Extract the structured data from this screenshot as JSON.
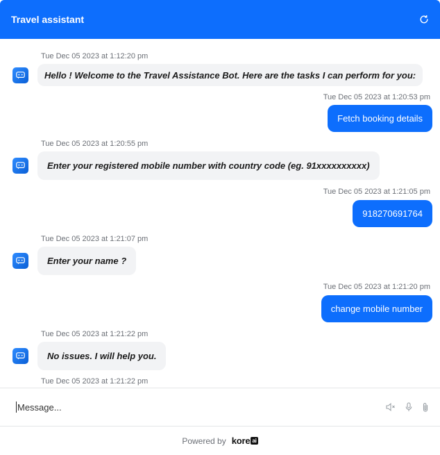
{
  "header": {
    "title": "Travel assistant",
    "refresh_icon": "refresh-icon"
  },
  "messages": [
    {
      "sender": "bot",
      "timestamp": "Tue Dec 05 2023 at 1:12:20 pm",
      "text": "Hello ! Welcome to the Travel Assistance Bot. Here are the tasks I can perform for you:"
    },
    {
      "sender": "user",
      "timestamp": "Tue Dec 05 2023 at 1:20:53 pm",
      "text": "Fetch booking details"
    },
    {
      "sender": "bot",
      "timestamp": "Tue Dec 05 2023 at 1:20:55 pm",
      "text": "Enter your registered mobile number with country code (eg. 91xxxxxxxxxx)"
    },
    {
      "sender": "user",
      "timestamp": "Tue Dec 05 2023 at 1:21:05 pm",
      "text": "918270691764"
    },
    {
      "sender": "bot",
      "timestamp": "Tue Dec 05 2023 at 1:21:07 pm",
      "text": "Enter your name ?"
    },
    {
      "sender": "user",
      "timestamp": "Tue Dec 05 2023 at 1:21:20 pm",
      "text": "change mobile number"
    },
    {
      "sender": "bot",
      "timestamp": "Tue Dec 05 2023 at 1:21:22 pm",
      "text": "No issues. I will help you."
    },
    {
      "sender": "bot",
      "timestamp": "Tue Dec 05 2023 at 1:21:22 pm",
      "text": ""
    }
  ],
  "composer": {
    "placeholder": "Message...",
    "icons": [
      "speaker-mute-icon",
      "microphone-icon",
      "attachment-icon"
    ]
  },
  "footer": {
    "powered_by": "Powered by",
    "brand": "kore",
    "brand_suffix": "ai"
  },
  "colors": {
    "accent": "#0d6efd",
    "bot_bubble": "#f2f3f5"
  }
}
